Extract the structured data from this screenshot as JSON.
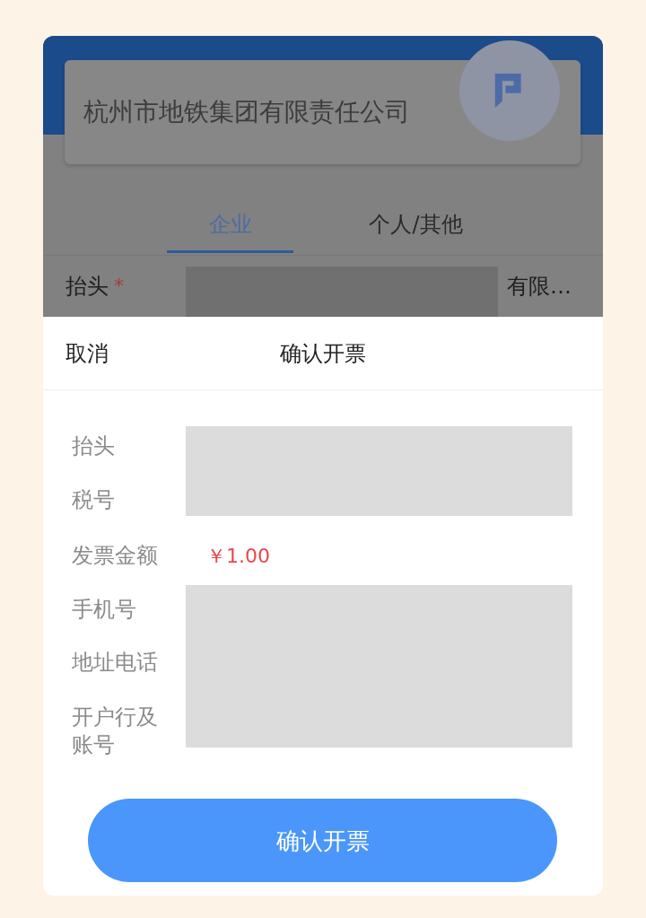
{
  "header": {
    "company_name": "杭州市地铁集团有限责任公司"
  },
  "tabs": [
    {
      "label": "企业",
      "selected": true
    },
    {
      "label": "个人/其他",
      "selected": false
    }
  ],
  "form_row": {
    "label": "抬头",
    "required_mark": "*",
    "value": "有限…"
  },
  "dialog": {
    "cancel": "取消",
    "title": "确认开票",
    "fields": [
      {
        "label": "抬头"
      },
      {
        "label": "税号"
      },
      {
        "label": "发票金额",
        "value": "￥1.00"
      },
      {
        "label": "手机号"
      },
      {
        "label": "地址电话"
      },
      {
        "label": "开户行及账号"
      }
    ],
    "confirm_button": "确认开票"
  }
}
